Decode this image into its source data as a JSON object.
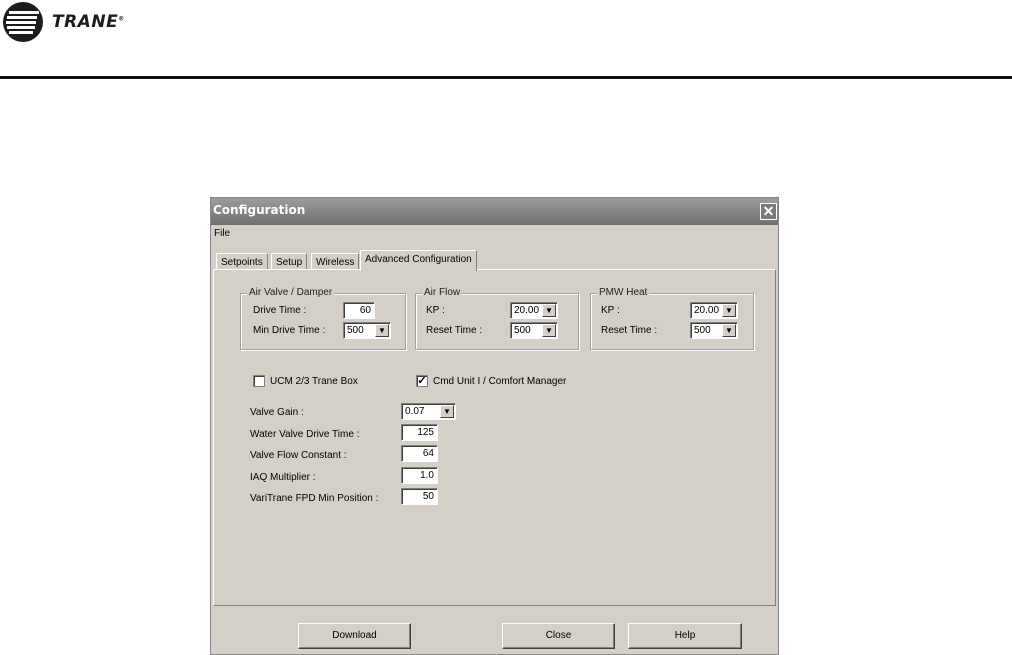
{
  "brand": {
    "name": "TRANE",
    "mark": "®"
  },
  "window": {
    "title": "Configuration",
    "close_glyph": "✕"
  },
  "menu": {
    "file": "File"
  },
  "tabs": [
    "Setpoints",
    "Setup",
    "Wireless",
    "Advanced Configuration"
  ],
  "active_tab": "Advanced Configuration",
  "air_valve": {
    "title": "Air Valve / Damper",
    "drive_time_label": "Drive Time :",
    "drive_time_value": "60",
    "min_drive_time_label": "Min Drive Time :",
    "min_drive_time_value": "500"
  },
  "air_flow": {
    "title": "Air Flow",
    "kp_label": "KP :",
    "kp_value": "20.00",
    "reset_time_label": "Reset Time :",
    "reset_time_value": "500"
  },
  "pmw_heat": {
    "title": "PMW Heat",
    "kp_label": "KP :",
    "kp_value": "20.00",
    "reset_time_label": "Reset Time :",
    "reset_time_value": "500"
  },
  "options": {
    "ucm_label": "UCM 2/3 Trane Box",
    "ucm_checked": false,
    "cmd_unit_label": "Cmd Unit I / Comfort Manager",
    "cmd_unit_checked": true,
    "check_glyph": "✓"
  },
  "fields": {
    "valve_gain_label": "Valve Gain :",
    "valve_gain_value": "0.07",
    "water_valve_label": "Water Valve Drive Time :",
    "water_valve_value": "125",
    "valve_flow_label": "Valve Flow Constant :",
    "valve_flow_value": "64",
    "iaq_label": "IAQ Multiplier :",
    "iaq_value": "1.0",
    "vartrane_label": "VariTrane FPD Min Position :",
    "vartrane_value": "50"
  },
  "buttons": {
    "download": "Download",
    "close": "Close",
    "help": "Help"
  },
  "colors": {
    "dialog_bg": "#d4d0c8",
    "titlebar": "#7a7a7a",
    "rule": "#111111"
  }
}
